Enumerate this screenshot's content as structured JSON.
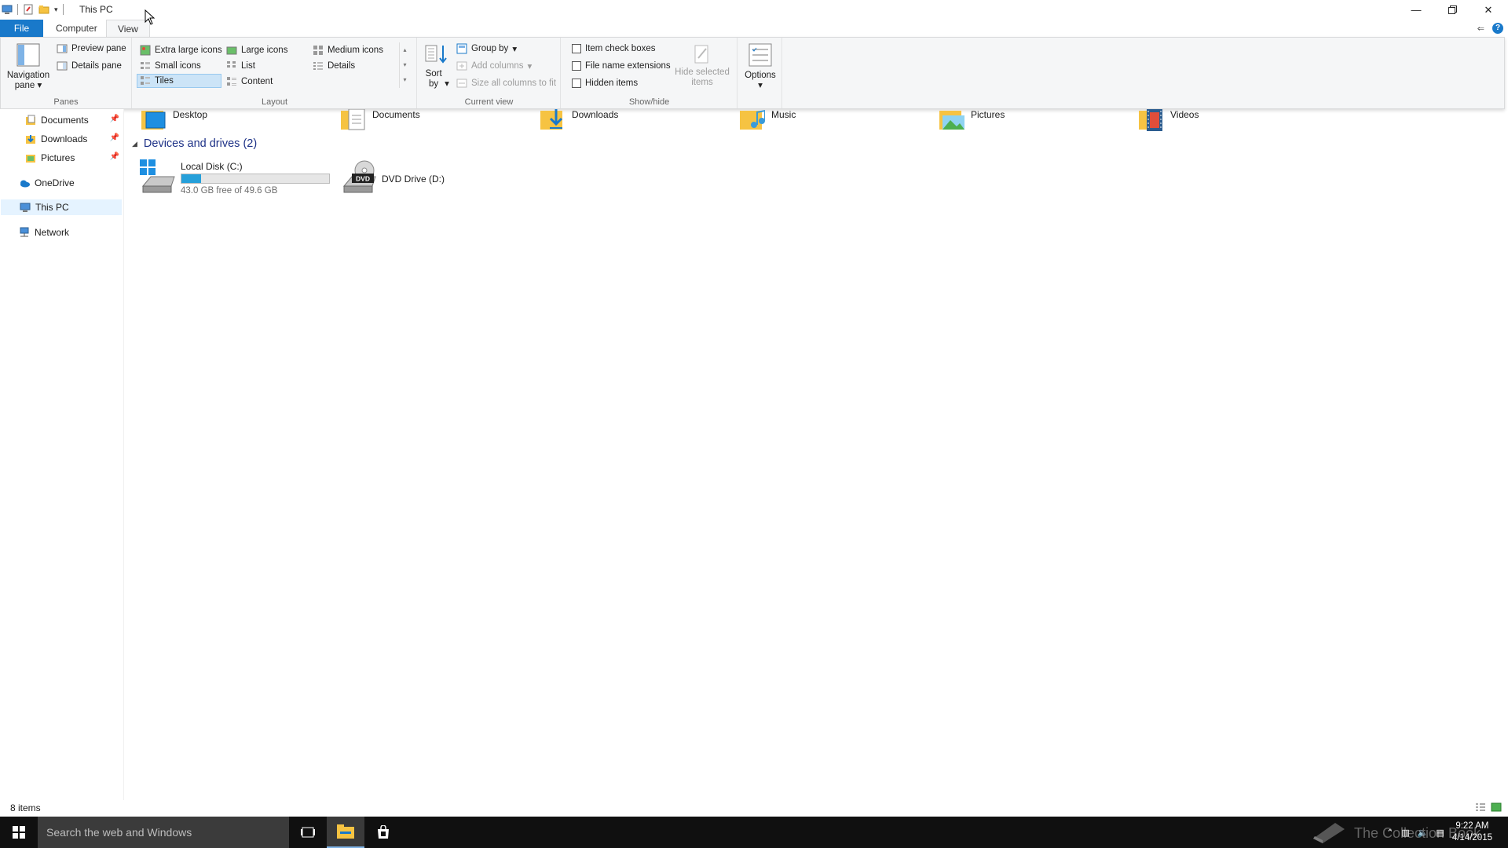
{
  "window": {
    "title": "This PC"
  },
  "tabs": {
    "file": "File",
    "computer": "Computer",
    "view": "View"
  },
  "ribbon": {
    "panes": {
      "label": "Panes",
      "navigation_pane": "Navigation pane",
      "preview_pane": "Preview pane",
      "details_pane": "Details pane"
    },
    "layout": {
      "label": "Layout",
      "extra_large_icons": "Extra large icons",
      "large_icons": "Large icons",
      "medium_icons": "Medium icons",
      "small_icons": "Small icons",
      "list": "List",
      "details": "Details",
      "tiles": "Tiles",
      "content": "Content",
      "selected": "Tiles"
    },
    "current_view": {
      "label": "Current view",
      "sort_by": "Sort by",
      "group_by": "Group by",
      "add_columns": "Add columns",
      "size_all_columns": "Size all columns to fit"
    },
    "show_hide": {
      "label": "Show/hide",
      "item_check_boxes": "Item check boxes",
      "file_name_extensions": "File name extensions",
      "hidden_items": "Hidden items",
      "hide_selected_items": "Hide selected items"
    },
    "options": {
      "label": "Options"
    }
  },
  "nav": {
    "items": [
      {
        "label": "Documents",
        "pinned": true
      },
      {
        "label": "Downloads",
        "pinned": true
      },
      {
        "label": "Pictures",
        "pinned": true
      },
      {
        "label": "OneDrive",
        "pinned": false
      },
      {
        "label": "This PC",
        "pinned": false
      },
      {
        "label": "Network",
        "pinned": false
      }
    ]
  },
  "content": {
    "folders": [
      "Desktop",
      "Documents",
      "Downloads",
      "Music",
      "Pictures",
      "Videos"
    ],
    "devices_header": "Devices and drives (2)",
    "drives": [
      {
        "name": "Local Disk (C:)",
        "free_text": "43.0 GB free of 49.6 GB",
        "used_fraction": 0.133
      },
      {
        "name": "DVD Drive (D:)",
        "badge": "DVD"
      }
    ]
  },
  "status": {
    "items": "8 items"
  },
  "taskbar": {
    "search_placeholder": "Search the web and Windows",
    "time": "9:22 AM",
    "date": "4/14/2015",
    "watermark": "The Collection Book"
  },
  "colors": {
    "accent": "#1979ca",
    "folder": "#f6c342",
    "drive_bar": "#26a0da"
  }
}
